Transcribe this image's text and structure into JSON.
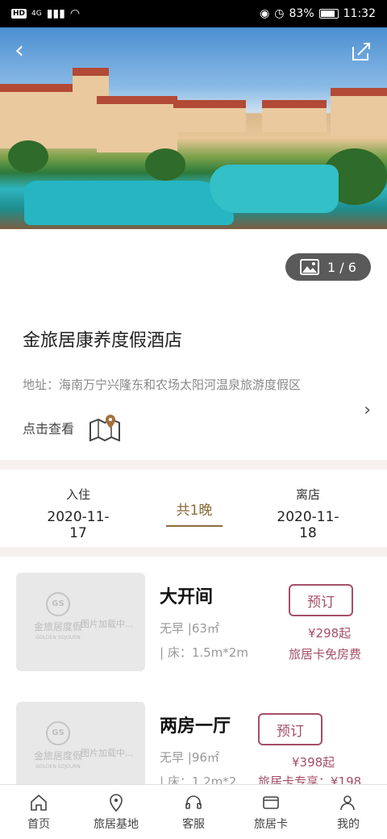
{
  "status_bar": {
    "network_badge": "HD",
    "network_type": "4G",
    "battery_percent": "83%",
    "time": "11:32"
  },
  "hero": {
    "photo_counter": "1 / 6"
  },
  "hotel": {
    "name": "金旅居康养度假酒店",
    "address": "地址：海南万宁兴隆东和农场太阳河温泉旅游度假区",
    "map_link_label": "点击查看"
  },
  "stay": {
    "checkin_label": "入住",
    "checkin_date": "2020-11-17",
    "nights": "共1晚",
    "checkout_label": "离店",
    "checkout_date": "2020-11-18"
  },
  "rooms": [
    {
      "title": "大开间",
      "breakfast_area": "无早 |63㎡",
      "bed": "| 床：1.5m*2m",
      "book_label": "预订",
      "price": "¥298起",
      "perk": "旅居卡免房费",
      "image_brand_cn": "金旅居度假",
      "image_brand_en": "GOLDEN SOJOURN",
      "image_logo": "GS",
      "image_loading": "图片加载中..."
    },
    {
      "title": "两房一厅",
      "breakfast_area": "无早 |96㎡",
      "bed": "| 床：1.2m*2...",
      "book_label": "预订",
      "price": "¥398起",
      "perk": "旅居卡专享：¥198",
      "image_brand_cn": "金旅居度假",
      "image_brand_en": "GOLDEN SOJOURN",
      "image_logo": "GS",
      "image_loading": "图片加载中..."
    }
  ],
  "tabbar": {
    "items": [
      {
        "label": "首页",
        "icon": "home-icon"
      },
      {
        "label": "旅居基地",
        "icon": "location-pin-icon"
      },
      {
        "label": "客服",
        "icon": "headset-icon"
      },
      {
        "label": "旅居卡",
        "icon": "vip-card-icon"
      },
      {
        "label": "我的",
        "icon": "user-icon"
      }
    ]
  },
  "colors": {
    "accent": "#a44f68",
    "gold": "#8a6b3a",
    "page_bg": "#f6f1ef"
  }
}
